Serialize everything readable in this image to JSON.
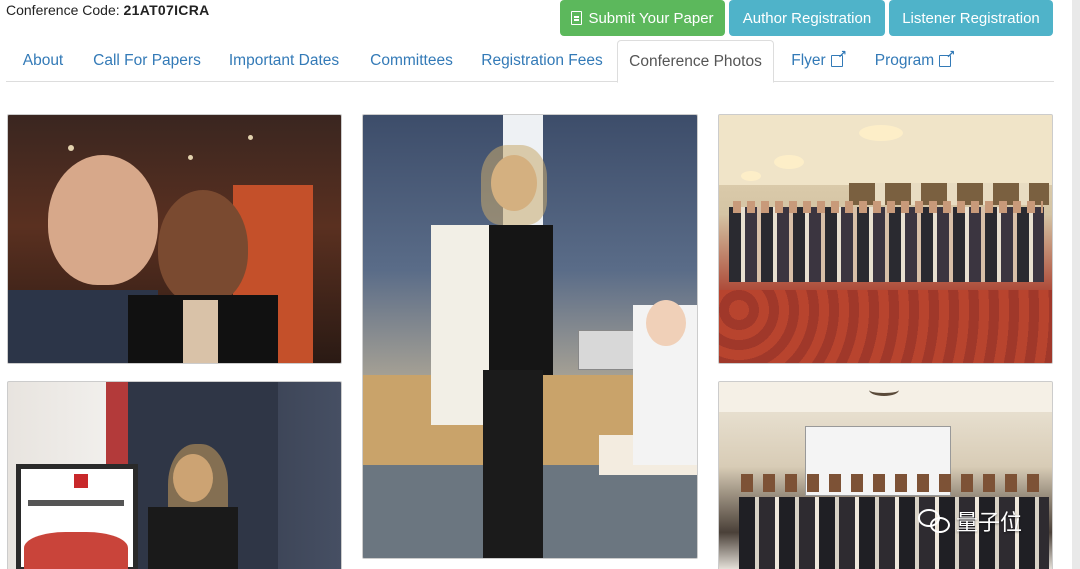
{
  "header": {
    "conference_code_label": "Conference Code:",
    "conference_code_value": "21AT07ICRA",
    "buttons": {
      "submit": "Submit Your Paper",
      "author": "Author Registration",
      "listener": "Listener Registration"
    }
  },
  "tabs": [
    {
      "label": "About"
    },
    {
      "label": "Call For Papers"
    },
    {
      "label": "Important Dates"
    },
    {
      "label": "Committees"
    },
    {
      "label": "Registration Fees"
    },
    {
      "label": "Conference Photos"
    },
    {
      "label": "Flyer"
    },
    {
      "label": "Program"
    }
  ],
  "active_tab": "Conference Photos",
  "watermark": {
    "text": "量子位"
  },
  "colors": {
    "green_button": "#5cb85c",
    "teal_button": "#4fb3c9",
    "link": "#337ab7"
  }
}
